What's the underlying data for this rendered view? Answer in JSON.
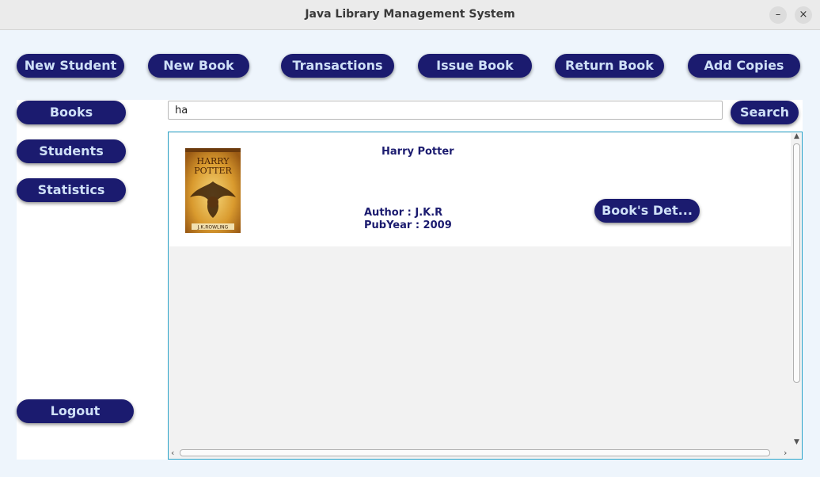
{
  "window": {
    "title": "Java Library Management System",
    "minimize_icon": "–",
    "close_icon": "×"
  },
  "toolbar": {
    "new_student": "New Student",
    "new_book": "New Book",
    "transactions": "Transactions",
    "issue_book": "Issue Book",
    "return_book": "Return Book",
    "add_copies": "Add Copies"
  },
  "sidebar": {
    "books": "Books",
    "students": "Students",
    "statistics": "Statistics",
    "logout": "Logout"
  },
  "search": {
    "value": "ha",
    "button": "Search"
  },
  "results": [
    {
      "title": "Harry Potter",
      "author": "Author : J.K.R",
      "pubyear": "PubYear : 2009",
      "details_button": "Book's Det...",
      "cover_text_top": "HARRY",
      "cover_text_mid": "POTTER",
      "cover_author": "J.K.ROWLING"
    }
  ],
  "colors": {
    "button_bg": "#1b1b6f",
    "button_text": "#cfe0f7",
    "window_bg": "#eef5fc",
    "accent_border": "#2aa3c9"
  }
}
